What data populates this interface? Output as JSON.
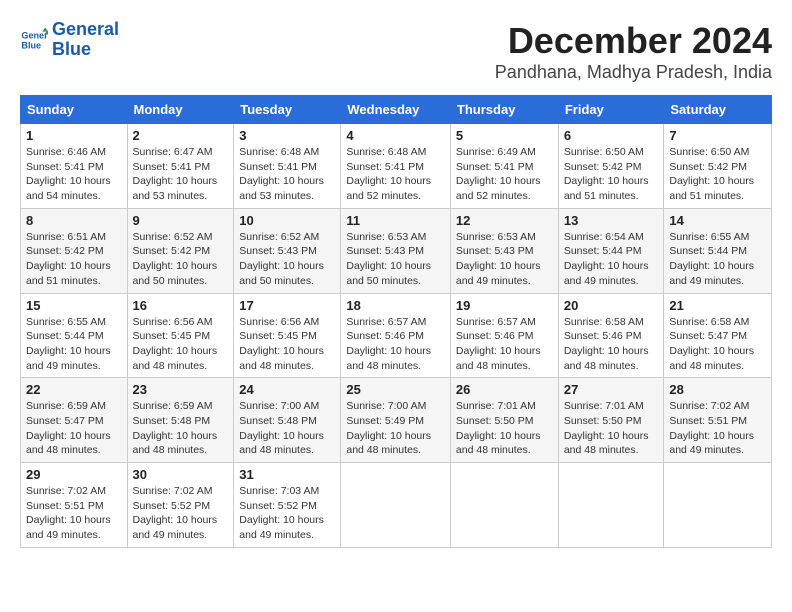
{
  "header": {
    "logo_line1": "General",
    "logo_line2": "Blue",
    "month_title": "December 2024",
    "location": "Pandhana, Madhya Pradesh, India"
  },
  "weekdays": [
    "Sunday",
    "Monday",
    "Tuesday",
    "Wednesday",
    "Thursday",
    "Friday",
    "Saturday"
  ],
  "weeks": [
    [
      {
        "day": "1",
        "sunrise": "6:46 AM",
        "sunset": "5:41 PM",
        "daylight": "10 hours and 54 minutes."
      },
      {
        "day": "2",
        "sunrise": "6:47 AM",
        "sunset": "5:41 PM",
        "daylight": "10 hours and 53 minutes."
      },
      {
        "day": "3",
        "sunrise": "6:48 AM",
        "sunset": "5:41 PM",
        "daylight": "10 hours and 53 minutes."
      },
      {
        "day": "4",
        "sunrise": "6:48 AM",
        "sunset": "5:41 PM",
        "daylight": "10 hours and 52 minutes."
      },
      {
        "day": "5",
        "sunrise": "6:49 AM",
        "sunset": "5:41 PM",
        "daylight": "10 hours and 52 minutes."
      },
      {
        "day": "6",
        "sunrise": "6:50 AM",
        "sunset": "5:42 PM",
        "daylight": "10 hours and 51 minutes."
      },
      {
        "day": "7",
        "sunrise": "6:50 AM",
        "sunset": "5:42 PM",
        "daylight": "10 hours and 51 minutes."
      }
    ],
    [
      {
        "day": "8",
        "sunrise": "6:51 AM",
        "sunset": "5:42 PM",
        "daylight": "10 hours and 51 minutes."
      },
      {
        "day": "9",
        "sunrise": "6:52 AM",
        "sunset": "5:42 PM",
        "daylight": "10 hours and 50 minutes."
      },
      {
        "day": "10",
        "sunrise": "6:52 AM",
        "sunset": "5:43 PM",
        "daylight": "10 hours and 50 minutes."
      },
      {
        "day": "11",
        "sunrise": "6:53 AM",
        "sunset": "5:43 PM",
        "daylight": "10 hours and 50 minutes."
      },
      {
        "day": "12",
        "sunrise": "6:53 AM",
        "sunset": "5:43 PM",
        "daylight": "10 hours and 49 minutes."
      },
      {
        "day": "13",
        "sunrise": "6:54 AM",
        "sunset": "5:44 PM",
        "daylight": "10 hours and 49 minutes."
      },
      {
        "day": "14",
        "sunrise": "6:55 AM",
        "sunset": "5:44 PM",
        "daylight": "10 hours and 49 minutes."
      }
    ],
    [
      {
        "day": "15",
        "sunrise": "6:55 AM",
        "sunset": "5:44 PM",
        "daylight": "10 hours and 49 minutes."
      },
      {
        "day": "16",
        "sunrise": "6:56 AM",
        "sunset": "5:45 PM",
        "daylight": "10 hours and 48 minutes."
      },
      {
        "day": "17",
        "sunrise": "6:56 AM",
        "sunset": "5:45 PM",
        "daylight": "10 hours and 48 minutes."
      },
      {
        "day": "18",
        "sunrise": "6:57 AM",
        "sunset": "5:46 PM",
        "daylight": "10 hours and 48 minutes."
      },
      {
        "day": "19",
        "sunrise": "6:57 AM",
        "sunset": "5:46 PM",
        "daylight": "10 hours and 48 minutes."
      },
      {
        "day": "20",
        "sunrise": "6:58 AM",
        "sunset": "5:46 PM",
        "daylight": "10 hours and 48 minutes."
      },
      {
        "day": "21",
        "sunrise": "6:58 AM",
        "sunset": "5:47 PM",
        "daylight": "10 hours and 48 minutes."
      }
    ],
    [
      {
        "day": "22",
        "sunrise": "6:59 AM",
        "sunset": "5:47 PM",
        "daylight": "10 hours and 48 minutes."
      },
      {
        "day": "23",
        "sunrise": "6:59 AM",
        "sunset": "5:48 PM",
        "daylight": "10 hours and 48 minutes."
      },
      {
        "day": "24",
        "sunrise": "7:00 AM",
        "sunset": "5:48 PM",
        "daylight": "10 hours and 48 minutes."
      },
      {
        "day": "25",
        "sunrise": "7:00 AM",
        "sunset": "5:49 PM",
        "daylight": "10 hours and 48 minutes."
      },
      {
        "day": "26",
        "sunrise": "7:01 AM",
        "sunset": "5:50 PM",
        "daylight": "10 hours and 48 minutes."
      },
      {
        "day": "27",
        "sunrise": "7:01 AM",
        "sunset": "5:50 PM",
        "daylight": "10 hours and 48 minutes."
      },
      {
        "day": "28",
        "sunrise": "7:02 AM",
        "sunset": "5:51 PM",
        "daylight": "10 hours and 49 minutes."
      }
    ],
    [
      {
        "day": "29",
        "sunrise": "7:02 AM",
        "sunset": "5:51 PM",
        "daylight": "10 hours and 49 minutes."
      },
      {
        "day": "30",
        "sunrise": "7:02 AM",
        "sunset": "5:52 PM",
        "daylight": "10 hours and 49 minutes."
      },
      {
        "day": "31",
        "sunrise": "7:03 AM",
        "sunset": "5:52 PM",
        "daylight": "10 hours and 49 minutes."
      },
      null,
      null,
      null,
      null
    ]
  ]
}
